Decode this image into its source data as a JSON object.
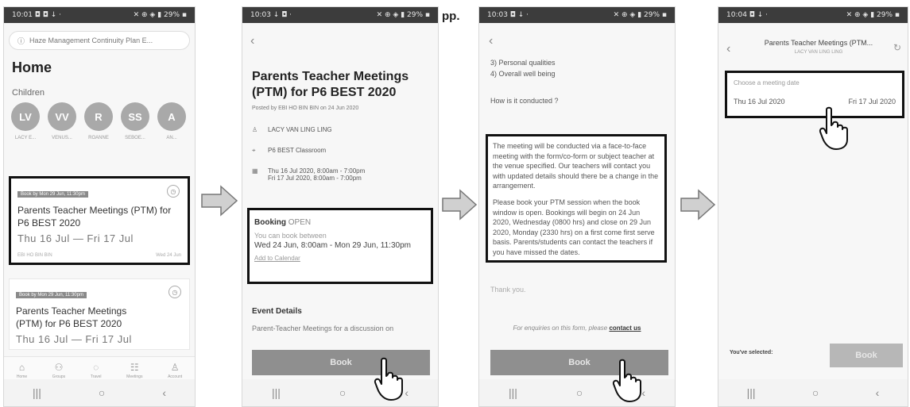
{
  "caption_fragment": "pp.",
  "screen1": {
    "status_left": "10:01 ◘ ◘ ↓ ·",
    "status_right": "✕ ⊕ ◈ ▮ 29% ▪",
    "url": "Haze Management Continuity Plan E...",
    "home_title": "Home",
    "children_label": "Children",
    "children": [
      {
        "initials": "LV",
        "name": "LACY E..."
      },
      {
        "initials": "VV",
        "name": "VENUS..."
      },
      {
        "initials": "R",
        "name": "ROANNE"
      },
      {
        "initials": "SS",
        "name": "SEBOE..."
      },
      {
        "initials": "A",
        "name": "AN..."
      }
    ],
    "cards": [
      {
        "tag": "Book by Mon 29 Jun, 11:30pm",
        "title": "Parents Teacher Meetings (PTM) for P6 BEST 2020",
        "date": "Thu 16 Jul — Fri 17 Jul",
        "foot_left": "EBI HO BIN BIN",
        "foot_right": "Wed 24 Jun"
      },
      {
        "tag": "Book by Mon 29 Jun, 11:30pm",
        "title": "(PTM) for P6 BEST 2020",
        "title_prefix": "Parents Teacher Meetings",
        "date": "Thu 16 Jul — Fri 17 Jul"
      }
    ],
    "tabs": [
      "Home",
      "Groups",
      "Travel",
      "Meetings",
      "Account"
    ]
  },
  "screen2": {
    "status_left": "10:03 ↓ ◘ ·",
    "status_right": "✕ ⊕ ◈ ▮ 29% ▪",
    "title": "Parents Teacher Meetings (PTM) for P6 BEST 2020",
    "posted": "Posted by EBI HO BIN BIN on 24 Jun 2020",
    "student": "LACY VAN LING LING",
    "venue": "P6 BEST Classroom",
    "dates_line1": "Thu 16 Jul 2020, 8:00am - 7:00pm",
    "dates_line2": "Fri 17 Jul 2020, 8:00am - 7:00pm",
    "booking_label": "Booking",
    "booking_status": "OPEN",
    "booking_sub": "You can book between",
    "booking_range": "Wed 24 Jun, 8:00am - Mon 29 Jun, 11:30pm",
    "add_calendar": "Add to Calendar",
    "event_details": "Event Details",
    "event_desc": "Parent-Teacher Meetings for a discussion on",
    "book_label": "Book"
  },
  "screen3": {
    "status_left": "10:03 ◘ ↓ ·",
    "status_right": "✕ ⊕ ◈ ▮ 29% ▪",
    "item3": "3) Personal qualities",
    "item4": "4) Overall well being",
    "how_q": "How is it conducted ?",
    "para1": "The meeting will be conducted via a face-to-face meeting with the form/co-form or subject teacher at the venue specified. Our teachers will contact you with updated details should there be a change in the arrangement.",
    "para2": "Please book your PTM session when the book window is open. Bookings will begin on 24 Jun 2020, Wednesday (0800 hrs) and close on 29 Jun 2020, Monday (2330 hrs) on a first come first serve basis. Parents/students can contact the teachers if you have missed the dates.",
    "thanks": "Thank you.",
    "enquiry_prefix": "For enquiries on this form, please",
    "enquiry_link": "contact us",
    "book_label": "Book"
  },
  "screen4": {
    "status_left": "10:04 ◘ ↓ ·",
    "status_right": "✕ ⊕ ◈ ▮ 29% ▪",
    "title": "Parents Teacher Meetings (PTM...",
    "subtitle": "LACY VAN LING LING",
    "date_label": "Choose a meeting date",
    "date_options": [
      "Thu 16 Jul 2020",
      "Fri 17 Jul 2020"
    ],
    "selected_label": "You've selected:",
    "book_label": "Book"
  },
  "android_nav": {
    "recents": "|||",
    "home": "○",
    "back": "‹"
  }
}
